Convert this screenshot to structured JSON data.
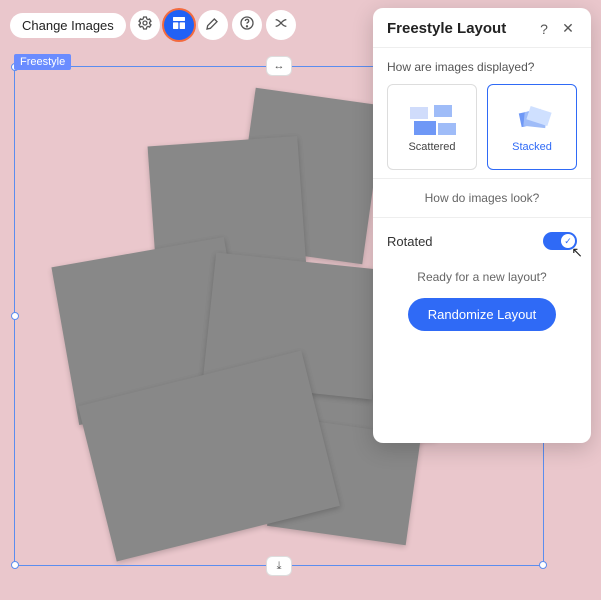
{
  "toolbar": {
    "change_images_label": "Change Images",
    "icons": [
      "gear-icon",
      "layout-icon",
      "brush-icon",
      "help-icon",
      "shuffle-icon"
    ],
    "active_index": 1
  },
  "badge": {
    "label": "Freestyle"
  },
  "panel": {
    "title": "Freestyle Layout",
    "q_display": "How are images displayed?",
    "options": [
      {
        "label": "Scattered",
        "selected": false
      },
      {
        "label": "Stacked",
        "selected": true
      }
    ],
    "section_look": "How do images look?",
    "rotated_label": "Rotated",
    "rotated_on": true,
    "q_new": "Ready for a new layout?",
    "randomize_label": "Randomize Layout"
  },
  "frame": {
    "download_icon": "⤓",
    "stretch_icon": "↔"
  },
  "colors": {
    "accent": "#2f6af6",
    "highlight": "#f36a3e"
  }
}
